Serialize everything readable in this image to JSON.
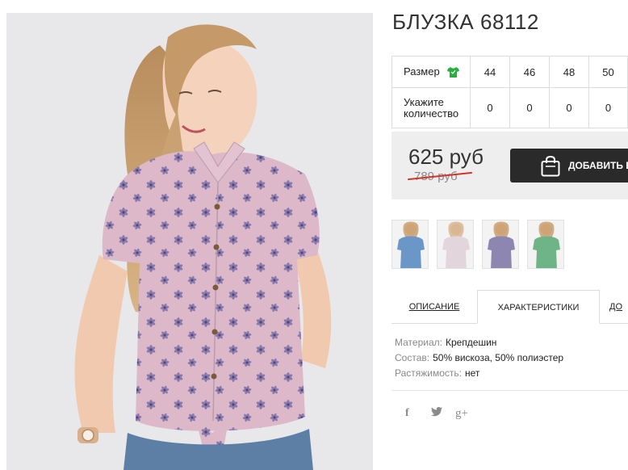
{
  "product": {
    "title": "БЛУЗКА 68112"
  },
  "size_table": {
    "size_label": "Размер",
    "qty_label_line1": "Укажите",
    "qty_label_line2": "количество",
    "sizes": [
      "44",
      "46",
      "48",
      "50"
    ],
    "quantities": [
      "0",
      "0",
      "0",
      "0"
    ]
  },
  "price": {
    "current": "625 руб",
    "old": "789 руб"
  },
  "cart": {
    "button_label": "ДОБАВИТЬ В"
  },
  "thumbnails": [
    {
      "shirt_color": "#6b97c8"
    },
    {
      "shirt_color": "#e2d6dc"
    },
    {
      "shirt_color": "#8c86b0"
    },
    {
      "shirt_color": "#6fb487"
    }
  ],
  "tabs": [
    {
      "label": "ОПИСАНИЕ",
      "active": false
    },
    {
      "label": "ХАРАКТЕРИСТИКИ",
      "active": true
    },
    {
      "label": "ДО",
      "active": false
    }
  ],
  "characteristics": [
    {
      "key": "Материал:",
      "value": "Крепдешин"
    },
    {
      "key": "Состав:",
      "value": "50% вискоза, 50% полиэстер"
    },
    {
      "key": "Растяжимость:",
      "value": "нет"
    }
  ],
  "share": {
    "facebook": "f",
    "twitter": "t",
    "googleplus": "g+"
  },
  "colors": {
    "accent_green": "#27ae3f",
    "button_dark": "#2a2a2a",
    "old_price_strike": "#d0342c",
    "blouse_pink": "#dcb8c8",
    "print_purple": "#7a6ea8"
  }
}
